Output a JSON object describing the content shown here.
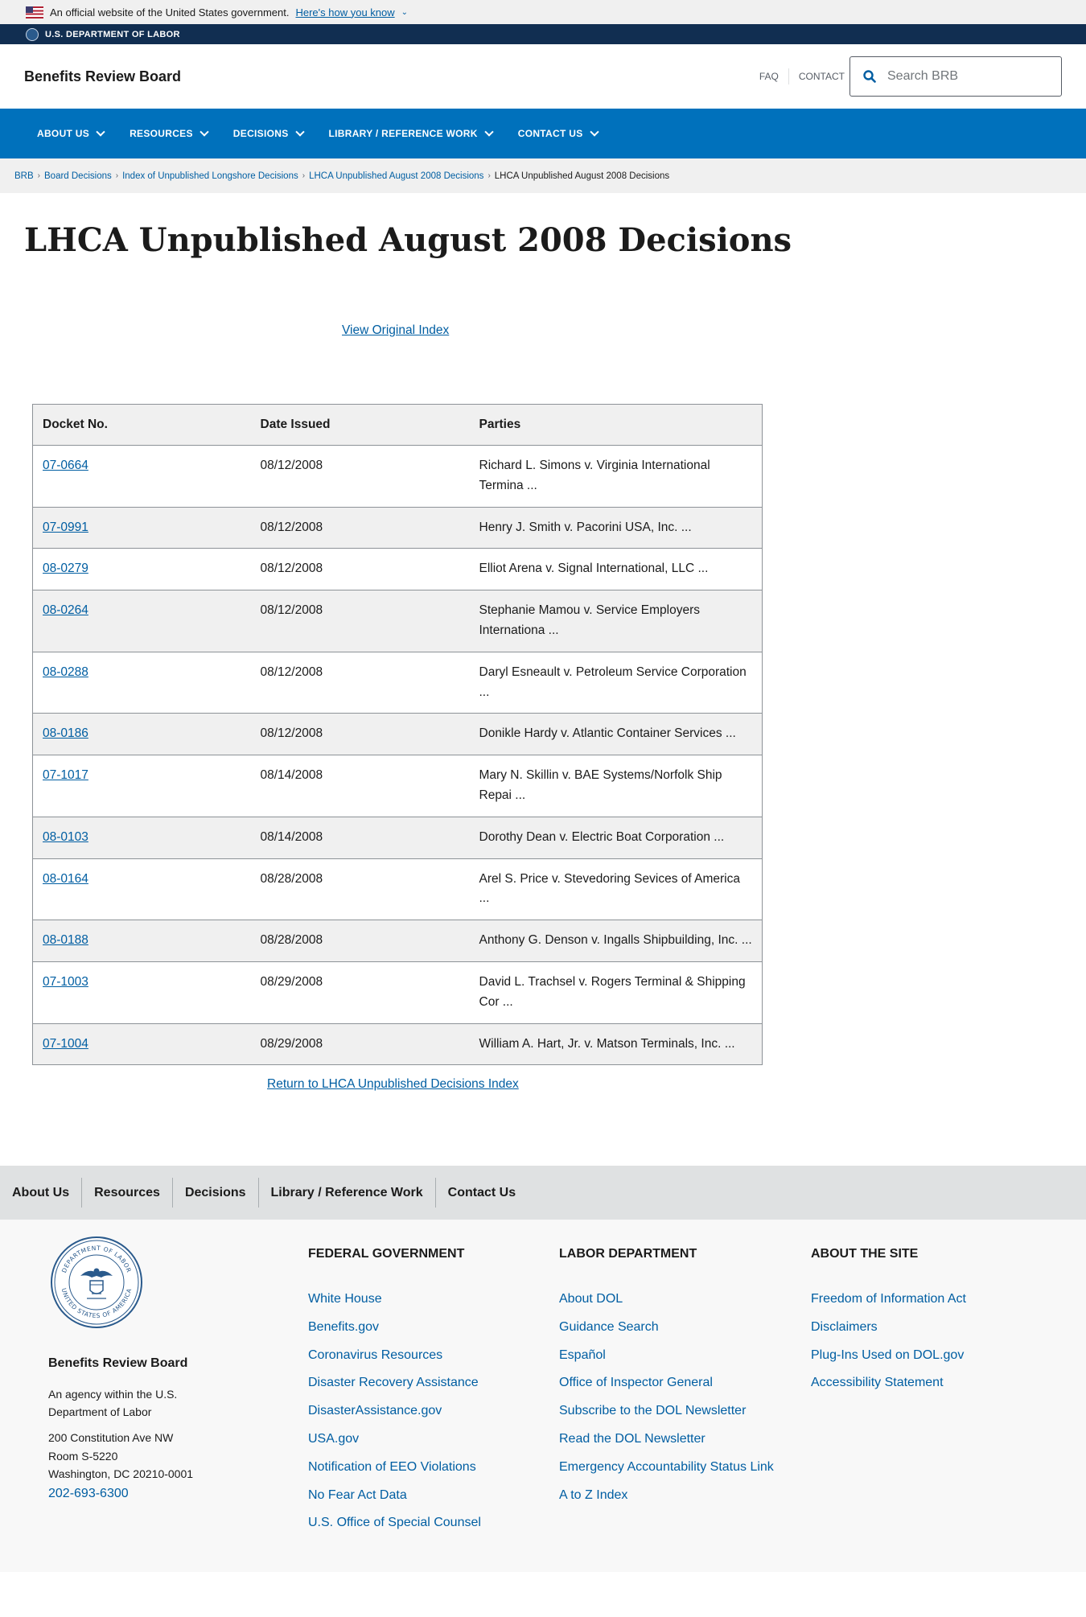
{
  "gov_banner": {
    "text": "An official website of the United States government.",
    "link": "Here's how you know"
  },
  "agency_strip": {
    "label": "U.S. DEPARTMENT OF LABOR"
  },
  "header": {
    "site_title": "Benefits Review Board",
    "faq": "FAQ",
    "contact": "CONTACT",
    "search_placeholder": "Search BRB"
  },
  "nav": {
    "items": [
      "ABOUT US",
      "RESOURCES",
      "DECISIONS",
      "LIBRARY / REFERENCE WORK",
      "CONTACT US"
    ]
  },
  "breadcrumb": {
    "items": [
      "BRB",
      "Board Decisions",
      "Index of Unpublished Longshore Decisions",
      "LHCA Unpublished August 2008 Decisions"
    ],
    "current": "LHCA Unpublished August 2008 Decisions"
  },
  "page_title": "LHCA Unpublished August 2008 Decisions",
  "view_original": "View Original Index",
  "table": {
    "headers": [
      "Docket No.",
      "Date Issued",
      "Parties"
    ],
    "rows": [
      {
        "docket": "07-0664",
        "date": "08/12/2008",
        "parties": "Richard L. Simons v. Virginia International Termina ..."
      },
      {
        "docket": "07-0991",
        "date": "08/12/2008",
        "parties": "Henry J. Smith v. Pacorini USA, Inc. ..."
      },
      {
        "docket": "08-0279",
        "date": "08/12/2008",
        "parties": "Elliot Arena v. Signal International, LLC ..."
      },
      {
        "docket": "08-0264",
        "date": "08/12/2008",
        "parties": "Stephanie Mamou v. Service Employers Internationa ..."
      },
      {
        "docket": "08-0288",
        "date": "08/12/2008",
        "parties": "Daryl Esneault v. Petroleum Service Corporation ..."
      },
      {
        "docket": "08-0186",
        "date": "08/12/2008",
        "parties": "Donikle Hardy v. Atlantic Container Services ..."
      },
      {
        "docket": "07-1017",
        "date": "08/14/2008",
        "parties": "Mary N. Skillin v. BAE Systems/Norfolk Ship Repai ..."
      },
      {
        "docket": "08-0103",
        "date": "08/14/2008",
        "parties": "Dorothy Dean v. Electric Boat Corporation ..."
      },
      {
        "docket": "08-0164",
        "date": "08/28/2008",
        "parties": "Arel S. Price v. Stevedoring Sevices of America ..."
      },
      {
        "docket": "08-0188",
        "date": "08/28/2008",
        "parties": "Anthony G. Denson v. Ingalls Shipbuilding, Inc. ..."
      },
      {
        "docket": "07-1003",
        "date": "08/29/2008",
        "parties": "David L. Trachsel v. Rogers Terminal & Shipping Cor ..."
      },
      {
        "docket": "07-1004",
        "date": "08/29/2008",
        "parties": "William A. Hart, Jr. v. Matson Terminals, Inc. ..."
      }
    ]
  },
  "return_link": "Return to LHCA Unpublished Decisions Index",
  "footer_nav": [
    "About Us",
    "Resources",
    "Decisions",
    "Library / Reference Work",
    "Contact Us"
  ],
  "footer": {
    "seal_text": [
      "DEPARTMENT OF LABOR",
      "UNITED STATES OF AMERICA"
    ],
    "agency_name": "Benefits Review Board",
    "agency_desc": "An agency within the U.S. Department of Labor",
    "address_lines": [
      "200 Constitution Ave NW",
      "Room S-5220",
      "Washington, DC 20210-0001"
    ],
    "phone": "202-693-6300",
    "columns": [
      {
        "heading": "FEDERAL GOVERNMENT",
        "links": [
          "White House",
          "Benefits.gov",
          "Coronavirus Resources",
          "Disaster Recovery Assistance",
          "DisasterAssistance.gov",
          "USA.gov",
          "Notification of EEO Violations",
          "No Fear Act Data",
          "U.S. Office of Special Counsel"
        ]
      },
      {
        "heading": "LABOR DEPARTMENT",
        "links": [
          "About DOL",
          "Guidance Search",
          "Español",
          "Office of Inspector General",
          "Subscribe to the DOL Newsletter",
          "Read the DOL Newsletter",
          "Emergency Accountability Status Link",
          "A to Z Index"
        ]
      },
      {
        "heading": "ABOUT THE SITE",
        "links": [
          "Freedom of Information Act",
          "Disclaimers",
          "Plug-Ins Used on DOL.gov",
          "Accessibility Statement"
        ]
      }
    ]
  }
}
